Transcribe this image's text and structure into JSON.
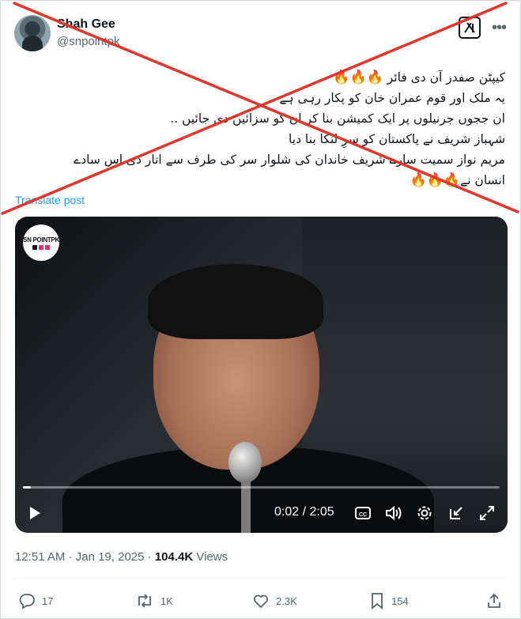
{
  "post": {
    "author_name": "Shah Gee",
    "author_handle": "@snpointpk",
    "text_lines": [
      "کیپٹن صفدر آن دی فائر",
      "یہ ملک اور قوم عمران خان کو پکار رہی ہے",
      "ان ججوں جرنیلوں پر ایک کمیشن بنا کر ان کو سزائیں دی جائیں ..",
      "شہباز شریف نے پاکستان کو سرِ لنکا بنا دیا",
      "مریم نواز سمیت سارے شریف خاندان کی شلوار سر کی طرف سے اتار دی اس سادے",
      "انسان نے"
    ],
    "emoji_line1": "🔥🔥🔥",
    "emoji_line6": "🔥🔥🔥",
    "translate_label": "Translate post"
  },
  "video": {
    "watermark": "SN POINTPK",
    "current_time": "0:02",
    "separator": " / ",
    "duration": "2:05",
    "progress_fraction": 0.016
  },
  "meta": {
    "time": "12:51 AM",
    "dot1": " · ",
    "date": "Jan 19, 2025",
    "dot2": " · ",
    "views_count": "104.4K",
    "views_label": " Views"
  },
  "actions": {
    "replies": "17",
    "reposts": "1K",
    "likes": "2.3K",
    "bookmarks": "154"
  },
  "colors": {
    "overlay_x": "#e0362c",
    "link": "#1d9bf0",
    "secondary": "#536471"
  }
}
